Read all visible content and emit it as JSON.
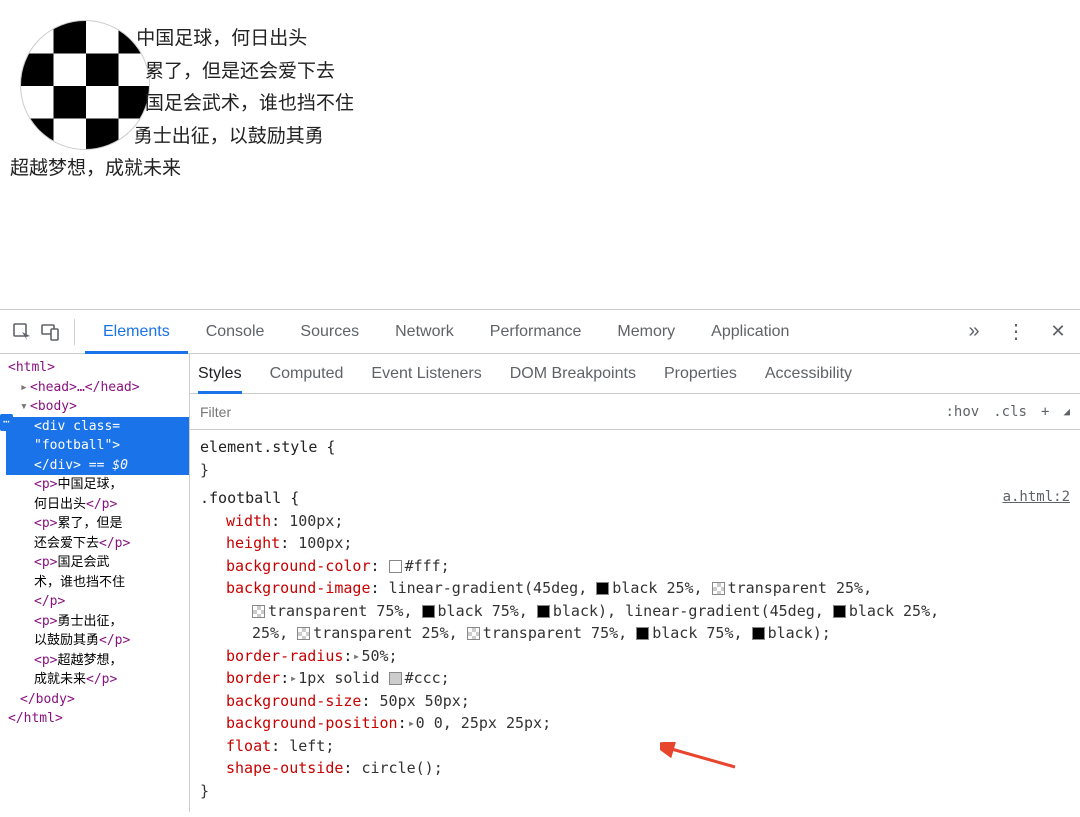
{
  "paragraphs": {
    "p1": "中国足球，何日出头",
    "p2": "累了，但是还会爱下去",
    "p3": "国足会武术，谁也挡不住",
    "p4": "勇士出征，以鼓励其勇",
    "p5": "超越梦想，成就未来"
  },
  "devtoolsTabs": {
    "elements": "Elements",
    "console": "Console",
    "sources": "Sources",
    "network": "Network",
    "performance": "Performance",
    "memory": "Memory",
    "application": "Application"
  },
  "sidebarTabs": {
    "styles": "Styles",
    "computed": "Computed",
    "eventListeners": "Event Listeners",
    "domBreakpoints": "DOM Breakpoints",
    "properties": "Properties",
    "accessibility": "Accessibility"
  },
  "filter": {
    "placeholder": "Filter",
    "hov": ":hov",
    "cls": ".cls",
    "plus": "+"
  },
  "dom": {
    "html_open": "<html>",
    "head": "<head>…</head>",
    "body_open": "<body>",
    "div_open": "<div class=",
    "div_class_val": "\"football\">",
    "div_close": "</div>",
    "eq0": " == $0",
    "p1a": "<p>中国足球，",
    "p1b": "何日出头</p>",
    "p2a": "<p>累了，但是",
    "p2b": "还会爱下去</p>",
    "p3a": "<p>国足会武",
    "p3b": "术，谁也挡不住",
    "p3c": "</p>",
    "p4a": "<p>勇士出征，",
    "p4b": "以鼓励其勇</p>",
    "p5a": "<p>超越梦想，",
    "p5b": "成就未来</p>",
    "body_close": "</body>",
    "html_close": "</html>"
  },
  "css": {
    "elementStyle": "element.style {",
    "closeBrace": "}",
    "selector": ".football {",
    "sourceLink": "a.html:2",
    "width_p": "width",
    "width_v": "100px;",
    "height_p": "height",
    "height_v": "100px;",
    "bgcolor_p": "background-color",
    "bgcolor_v": "#fff;",
    "bgimg_p": "background-image",
    "bgimg_v1": "linear-gradient(45deg, ",
    "bgimg_v_black25": "black 25%, ",
    "bgimg_v_trans25": "transparent 25%, ",
    "bgimg_v_trans75": "transparent 75%, ",
    "bgimg_v_black75": "black 75%, ",
    "bgimg_v_black_end": "black), linear-gradient(45deg, ",
    "bgimg_v_black25b": "black 25%, ",
    "bgimg_v_trans25b": "transparent 25%, ",
    "bgimg_v_trans75b": "transparent 75%, ",
    "bgimg_v_black75b": "black 75%, ",
    "bgimg_v_final": "black);",
    "bradius_p": "border-radius",
    "bradius_v": "50%;",
    "border_p": "border",
    "border_v": "1px solid ",
    "border_color": "#ccc;",
    "bgsize_p": "background-size",
    "bgsize_v": "50px 50px;",
    "bgpos_p": "background-position",
    "bgpos_v": "0 0, 25px 25px;",
    "float_p": "float",
    "float_v": "left;",
    "shape_p": "shape-outside",
    "shape_v": "circle();"
  }
}
